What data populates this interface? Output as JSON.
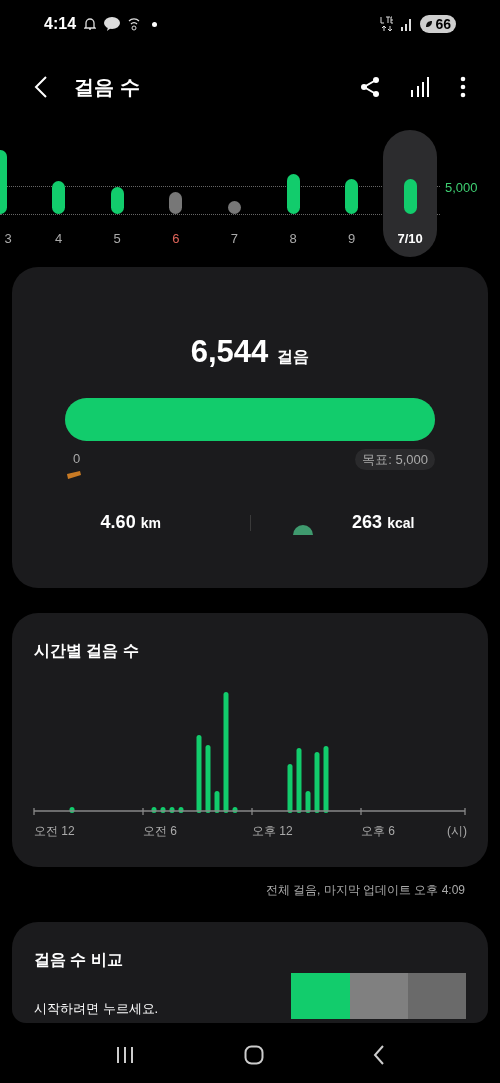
{
  "status_bar": {
    "time": "4:14",
    "battery": "66"
  },
  "header": {
    "title": "걸음 수"
  },
  "days": [
    {
      "label": "3",
      "goal_met": true,
      "sunday": false,
      "selected": false
    },
    {
      "label": "4",
      "goal_met": true,
      "sunday": false,
      "selected": false
    },
    {
      "label": "5",
      "goal_met": true,
      "sunday": false,
      "selected": false
    },
    {
      "label": "6",
      "goal_met": false,
      "sunday": true,
      "selected": false
    },
    {
      "label": "7",
      "goal_met": false,
      "sunday": false,
      "selected": false
    },
    {
      "label": "8",
      "goal_met": true,
      "sunday": false,
      "selected": false
    },
    {
      "label": "9",
      "goal_met": true,
      "sunday": false,
      "selected": false
    },
    {
      "label": "7/10",
      "goal_met": true,
      "sunday": false,
      "selected": true
    }
  ],
  "goal_line_label": "5,000",
  "summary": {
    "steps": "6,544",
    "steps_unit": "걸음",
    "level": 1,
    "start_label": "0",
    "goal_label": "목표: 5,000",
    "distance": "4.60",
    "distance_unit": "km",
    "calories": "263",
    "calories_unit": "kcal"
  },
  "hourly": {
    "title": "시간별 걸음 수",
    "x_labels": [
      "오전 12",
      "오전 6",
      "오후 12",
      "오후 6",
      "(시)"
    ]
  },
  "footnote": "전체 걸음, 마지막 업데이트 오후 4:09",
  "compare": {
    "title": "걸음 수 비교",
    "subtitle": "시작하려면 누르세요."
  }
}
